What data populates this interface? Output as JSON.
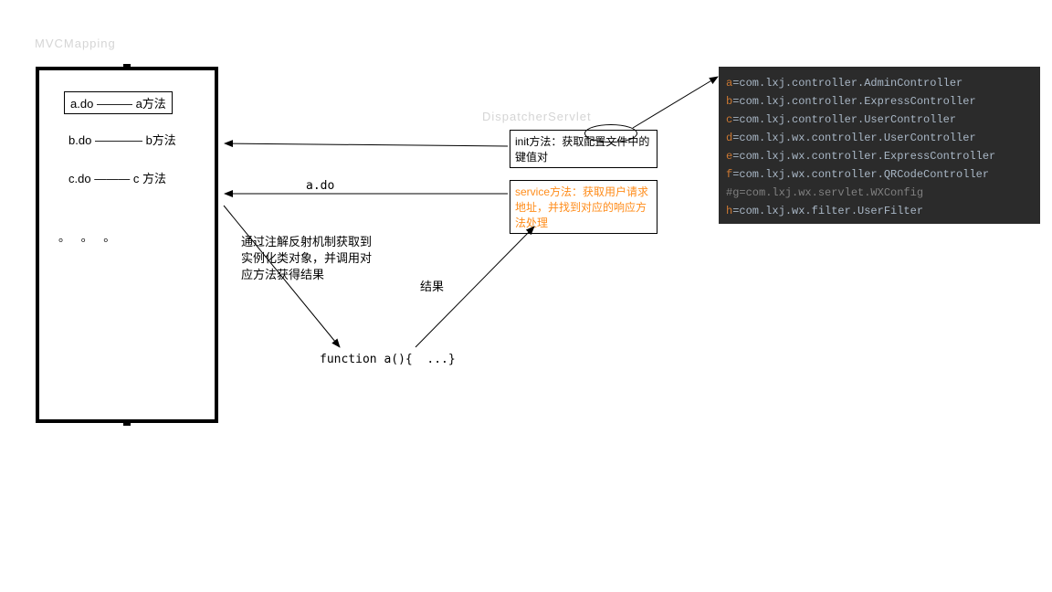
{
  "title_mvc": "MVCMapping",
  "title_dispatcher": "DispatcherServlet",
  "mapping": {
    "a": {
      "left": "a.do",
      "line": "———",
      "right": "a方法"
    },
    "b": {
      "left": "b.do",
      "line": "————",
      "right": "b方法"
    },
    "c": {
      "left": "c.do",
      "line": "———",
      "right": "c 方法"
    },
    "dots": "。 。 。"
  },
  "init_box": "init方法：获取配置文件中的键值对",
  "service_box": "service方法：获取用户请求地址，并找到对应的响应方法处理",
  "arrow_label_ado": "a.do",
  "reflect_text": "通过注解反射机制获取到实例化类对象，并调用对应方法获得结果",
  "result_label": "结果",
  "function_text": "function a(){  ...}",
  "code": {
    "lines": [
      {
        "k": "a",
        "v": "com.lxj.controller.AdminController"
      },
      {
        "k": "b",
        "v": "com.lxj.controller.ExpressController"
      },
      {
        "k": "c",
        "v": "com.lxj.controller.UserController"
      },
      {
        "k": "d",
        "v": "com.lxj.wx.controller.UserController"
      },
      {
        "k": "e",
        "v": "com.lxj.wx.controller.ExpressController"
      },
      {
        "k": "f",
        "v": "com.lxj.wx.controller.QRCodeController"
      }
    ],
    "comment": "#g=com.lxj.wx.servlet.WXConfig",
    "last": {
      "k": "h",
      "v": "com.lxj.wx.filter.UserFilter"
    }
  }
}
